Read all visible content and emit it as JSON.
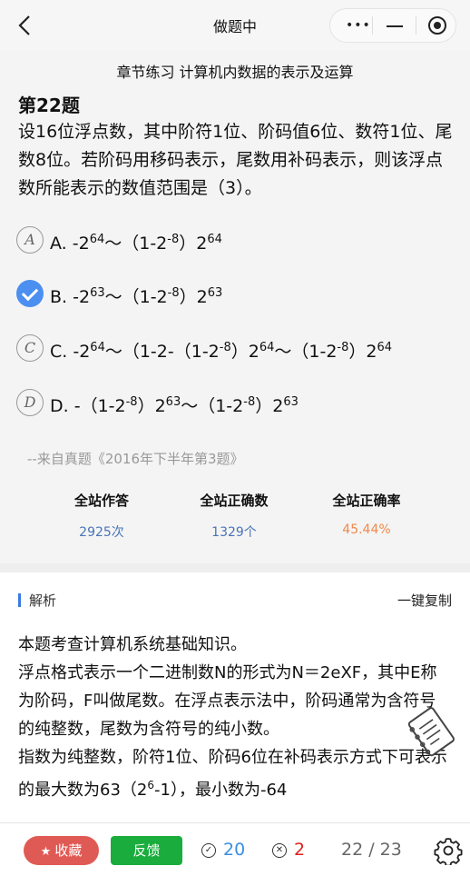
{
  "nav": {
    "title": "做题中",
    "more_glyph": "•••"
  },
  "chapter_title": "章节练习 计算机内数据的表示及运算",
  "question": {
    "number": "第22题",
    "text": "设16位浮点数，其中阶符1位、阶码值6位、数符1位、尾数8位。若阶码用移码表示，尾数用补码表示，则该浮点数所能表示的数值范围是（3）。",
    "options": [
      {
        "letter": "A",
        "text": "A. -2^64～（1-2^-8）2^64",
        "state": "unselected"
      },
      {
        "letter": "B",
        "text": "B. -2^63～（1-2^-8）2^63",
        "state": "selected-correct"
      },
      {
        "letter": "C",
        "text": "C. -2^64～（1-2-（1-2^-8）2^64～（1-2^-8）2^64",
        "state": "unselected"
      },
      {
        "letter": "D",
        "text": "D. -（1-2^-8）2^63～（1-2^-8）2^63",
        "state": "unselected"
      }
    ],
    "opt_parts": {
      "a": {
        "p1": "A. -2",
        "e1": "64",
        "p2": "～（1-2",
        "e2": "-8",
        "p3": "）2",
        "e3": "64"
      },
      "b": {
        "p1": "B. -2",
        "e1": "63",
        "p2": "～（1-2",
        "e2": "-8",
        "p3": "）2",
        "e3": "63"
      },
      "c": {
        "p1": "C. -2",
        "e1": "64",
        "p2": "～（1-2-（1-2",
        "e2": "-8",
        "p3": "）2",
        "e3": "64",
        "p4": "～（1-2",
        "e4": "-8",
        "p5": "）2",
        "e5": "64"
      },
      "d": {
        "p1": "D. -（1-2",
        "e1": "-8",
        "p2": "）2",
        "e2": "63",
        "p3": "～（1-2",
        "e3": "-8",
        "p4": "）2",
        "e4": "63"
      }
    },
    "source": "--来自真题《2016年下半年第3题》"
  },
  "stats": [
    {
      "label": "全站作答",
      "value": "2925次",
      "color": "#4a74b8"
    },
    {
      "label": "全站正确数",
      "value": "1329个",
      "color": "#4a74b8"
    },
    {
      "label": "全站正确率",
      "value": "45.44%",
      "color": "#f08a4b"
    }
  ],
  "analysis": {
    "title": "解析",
    "copy_label": "一键复制",
    "para1": "本题考查计算机系统基础知识。",
    "para2": "浮点格式表示一个二进制数N的形式为N＝2eXF，其中E称为阶码，F叫做尾数。在浮点表示法中，阶码通常为含符号的纯整数，尾数为含符号的纯小数。",
    "para3_a": "指数为纯整数，阶符1位、阶码6位在补码表示方式下可表示的最大数为63（2",
    "para3_exp": "6",
    "para3_b": "-1），最小数为-64"
  },
  "bottom": {
    "favorite_label": "收藏",
    "feedback_label": "反馈",
    "correct_count": "20",
    "wrong_count": "2",
    "page_indicator": "22 / 23",
    "accent_correct": "#3a8ee6",
    "accent_wrong": "#e02020"
  }
}
